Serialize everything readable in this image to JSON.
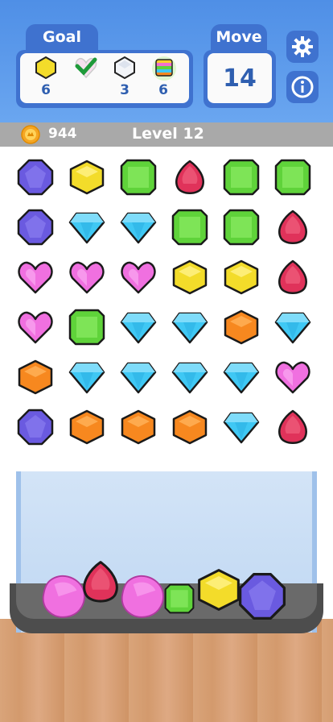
{
  "header": {
    "goal_label": "Goal",
    "move_label": "Move",
    "moves_left": "14",
    "goals": [
      {
        "icon": "yellow-hexagon-gem-icon",
        "count": "6",
        "done": false
      },
      {
        "icon": "pink-heart-gem-icon",
        "count": "",
        "done": true
      },
      {
        "icon": "white-diamond-gem-icon",
        "count": "3",
        "done": false
      },
      {
        "icon": "rainbow-gem-icon",
        "count": "6",
        "done": false
      }
    ],
    "buttons": [
      "gear-icon",
      "info-icon"
    ]
  },
  "status": {
    "coins": "944",
    "level": "Level 12"
  },
  "colors": {
    "purple": "#6a5ae0",
    "yellow": "#f3dc2a",
    "green": "#5fd33a",
    "red": "#e0325a",
    "blue": "#3fc8f4",
    "pink": "#f070e0",
    "orange": "#f7881f",
    "header_blue": "#3f72cf"
  },
  "board": {
    "rows": [
      [
        "purple-octagon",
        "yellow-hexagon",
        "green-square",
        "red-drop",
        "green-square",
        "green-square"
      ],
      [
        "purple-octagon",
        "blue-diamond",
        "blue-diamond",
        "green-square",
        "green-square",
        "red-drop"
      ],
      [
        "pink-heart",
        "pink-heart",
        "pink-heart",
        "yellow-hexagon",
        "yellow-hexagon",
        "red-drop"
      ],
      [
        "pink-heart",
        "green-square",
        "blue-diamond",
        "blue-diamond",
        "orange-hexagon",
        "blue-diamond"
      ],
      [
        "orange-hexagon",
        "blue-diamond",
        "blue-diamond",
        "blue-diamond",
        "blue-diamond",
        "pink-heart"
      ],
      [
        "purple-octagon",
        "orange-hexagon",
        "orange-hexagon",
        "orange-hexagon",
        "blue-diamond",
        "red-drop"
      ]
    ]
  },
  "jar": {
    "gems": [
      "pink-blob",
      "red-drop",
      "pink-blob",
      "green-square",
      "yellow-hexagon",
      "purple-octagon"
    ]
  }
}
